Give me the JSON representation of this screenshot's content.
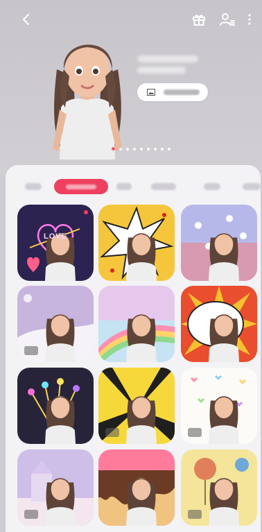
{
  "colors": {
    "accent": "#ef4060",
    "stage_bg": "#cbc8ce",
    "sheet_bg": "#f3f2f5"
  },
  "header": {
    "icons": [
      "back-icon",
      "gift-icon",
      "profile-list-icon",
      "more-icon"
    ]
  },
  "pager": {
    "count": 9,
    "active_index": 0
  },
  "tabs": [
    {
      "active": false
    },
    {
      "active": true
    },
    {
      "active": false
    },
    {
      "active": false
    },
    {
      "active": false
    },
    {
      "active": false
    }
  ],
  "stickers": [
    {
      "id": "sticker-love-neon",
      "caption": "LOVE",
      "new": true,
      "has_badge": false
    },
    {
      "id": "sticker-comic-burst",
      "new": false,
      "has_badge": false
    },
    {
      "id": "sticker-unicorn-sky",
      "new": false,
      "has_badge": false
    },
    {
      "id": "sticker-snow-hill",
      "new": false,
      "has_badge": true
    },
    {
      "id": "sticker-rainbow",
      "new": false,
      "has_badge": false
    },
    {
      "id": "sticker-speech-bubble",
      "new": false,
      "has_badge": false
    },
    {
      "id": "sticker-fireworks",
      "new": false,
      "has_badge": false
    },
    {
      "id": "sticker-light-rays",
      "new": false,
      "has_badge": true
    },
    {
      "id": "sticker-hearts",
      "new": false,
      "has_badge": true
    },
    {
      "id": "sticker-castle",
      "new": false,
      "has_badge": true
    },
    {
      "id": "sticker-dripping-chocolate",
      "new": false,
      "has_badge": false
    },
    {
      "id": "sticker-balloons",
      "new": false,
      "has_badge": true
    }
  ]
}
